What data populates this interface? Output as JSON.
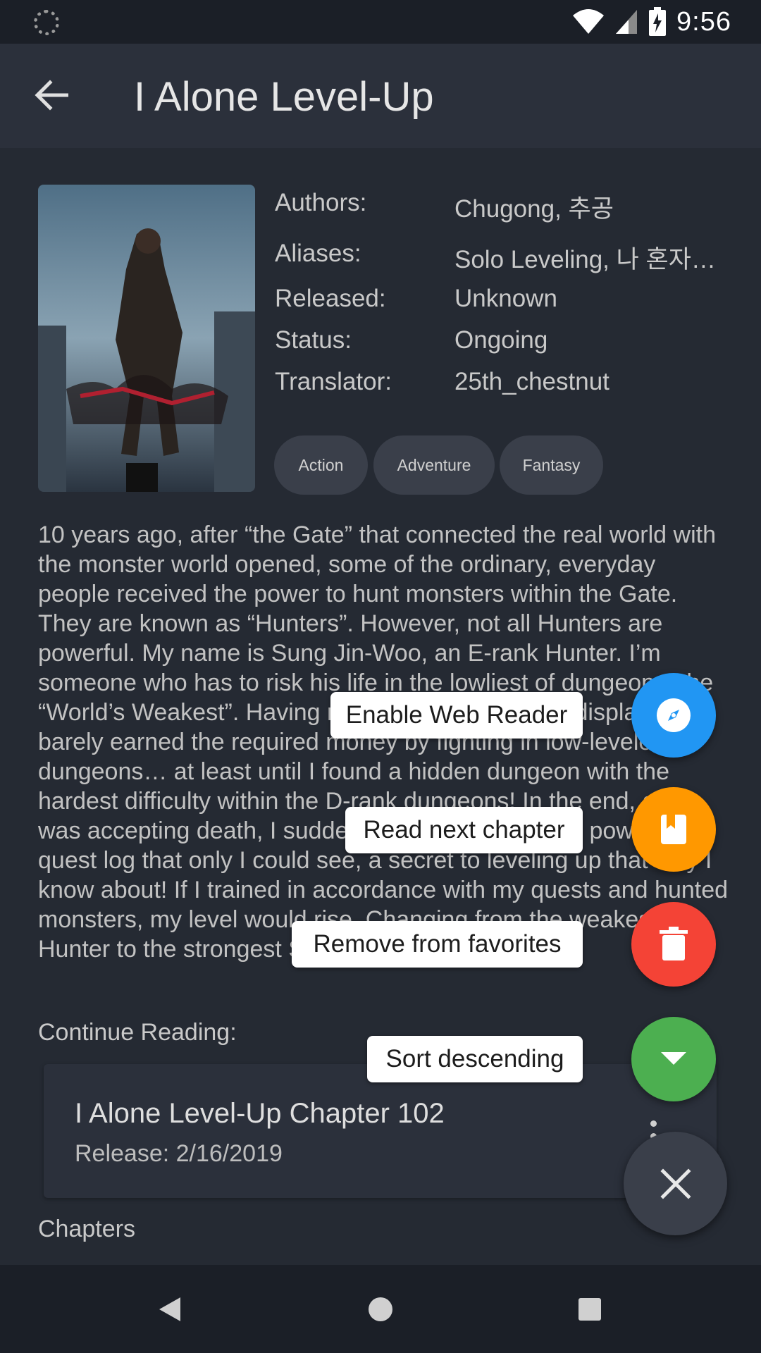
{
  "status_bar": {
    "time": "9:56"
  },
  "app_bar": {
    "title": "I Alone Level-Up",
    "back_icon": "arrow-back-icon"
  },
  "details": {
    "labels": {
      "authors": "Authors:",
      "aliases": "Aliases:",
      "released": "Released:",
      "status": "Status:",
      "translator": "Translator:"
    },
    "values": {
      "authors": "Chugong,  추공",
      "aliases": "Solo Leveling, 나 혼자…",
      "released": "Unknown",
      "status": "Ongoing",
      "translator": "25th_chestnut"
    },
    "genres": [
      "Action",
      "Adventure",
      "Fantasy"
    ]
  },
  "description": "10 years ago, after “the Gate” that connected the real world with the monster world opened, some of the ordinary, everyday people received the power to hunt monsters within the Gate. They are known as “Hunters”. However, not all Hunters are powerful. My name is Sung Jin-Woo, an E-rank Hunter. I’m someone who has to risk his life in the lowliest of dungeons, the “World’s Weakest”. Having no skills whatsoever to display, I barely earned the required money by fighting in low-leveled dungeons… at least until I found a hidden dungeon with the hardest difficulty within the D-rank dungeons! In the end, as I was accepting death, I suddenly received a strange power, a quest log that only I could see, a secret to leveling up that only I know about! If I trained in accordance with my quests and hunted monsters, my level would rise. Changing from the weakest Hunter to the strongest S-rank Hunter!",
  "continue": {
    "label": "Continue Reading:",
    "chapter_title": "I Alone Level-Up Chapter 102",
    "release": "Release: 2/16/2019"
  },
  "next_heading": "Chapters",
  "fab_menu": {
    "items": [
      {
        "label": "Enable Web Reader",
        "icon": "compass-icon",
        "color": "#2196f3"
      },
      {
        "label": "Read next chapter",
        "icon": "book-icon",
        "color": "#ff9800"
      },
      {
        "label": "Remove from favorites",
        "icon": "trash-icon",
        "color": "#f44336"
      },
      {
        "label": "Sort descending",
        "icon": "arrow-drop-down-icon",
        "color": "#4caf50"
      }
    ],
    "close_icon": "close-icon"
  },
  "nav_bar": {
    "back": "nav-back-icon",
    "home": "nav-home-icon",
    "recents": "nav-recents-icon"
  }
}
